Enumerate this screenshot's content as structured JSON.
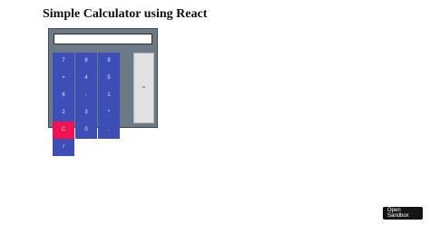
{
  "page": {
    "title": "Simple Calculator using React"
  },
  "calculator": {
    "display_value": "",
    "keys": [
      "7",
      "8",
      "9",
      "+",
      "4",
      "5",
      "6",
      "-",
      "1",
      "2",
      "3",
      "*",
      "C",
      "0",
      ".",
      "/"
    ],
    "equals_label": "="
  },
  "sandbox": {
    "label": "Open Sandbox"
  },
  "colors": {
    "key": "#3d4fb6",
    "clear_key": "#f01253",
    "calculator_body": "#6b7a86",
    "equals_key": "#e1e1e1"
  }
}
